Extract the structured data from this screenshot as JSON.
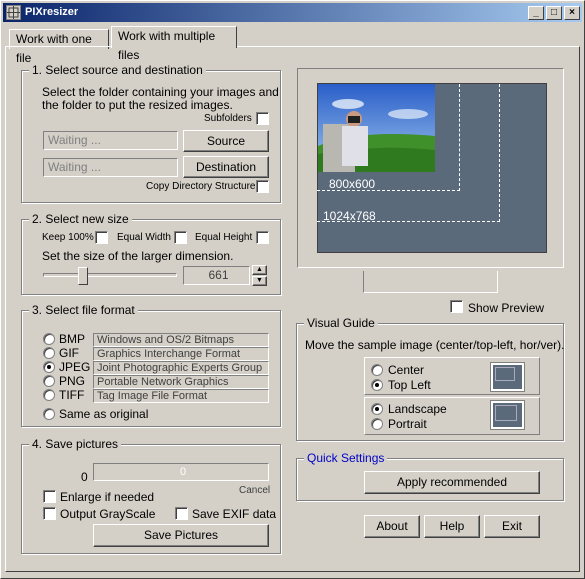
{
  "window": {
    "title": "PIXresizer"
  },
  "tabs": [
    {
      "label": "Work with one file"
    },
    {
      "label": "Work with multiple files"
    }
  ],
  "source_group": {
    "legend": "1. Select source and destination",
    "description_line1": "Select the folder containing your images and",
    "description_line2": "the folder to put the resized images.",
    "subfolders_label": "Subfolders",
    "source_value": "Waiting ...",
    "source_button": "Source",
    "destination_value": "Waiting ...",
    "destination_button": "Destination",
    "copy_structure_label": "Copy Directory Structure"
  },
  "size_group": {
    "legend": "2. Select new size",
    "keep_label": "Keep 100%",
    "equal_width_label": "Equal Width",
    "equal_height_label": "Equal Height",
    "instruction": "Set the size of the larger dimension.",
    "size_value": "661",
    "slider_fraction": 0.28
  },
  "format_group": {
    "legend": "3. Select file format",
    "formats": [
      {
        "name": "BMP",
        "desc": "Windows and OS/2 Bitmaps",
        "selected": false
      },
      {
        "name": "GIF",
        "desc": "Graphics Interchange Format",
        "selected": false
      },
      {
        "name": "JPEG",
        "desc": "Joint Photographic Experts Group",
        "selected": true
      },
      {
        "name": "PNG",
        "desc": "Portable Network Graphics",
        "selected": false
      },
      {
        "name": "TIFF",
        "desc": "Tag Image File Format",
        "selected": false
      }
    ],
    "same_as_original": "Same as original"
  },
  "save_group": {
    "legend": "4. Save pictures",
    "count": "0",
    "progress_text": "0",
    "cancel_label": "Cancel",
    "enlarge_label": "Enlarge if needed",
    "grayscale_label": "Output GrayScale",
    "exif_label": "Save EXIF data",
    "save_button": "Save Pictures"
  },
  "preview": {
    "label_800": "800x600",
    "label_1024": "1024x768",
    "show_preview_label": "Show Preview"
  },
  "visual_guide": {
    "legend": "Visual Guide",
    "instruction": "Move the sample image (center/top-left, hor/ver).",
    "center_label": "Center",
    "topleft_label": "Top Left",
    "landscape_label": "Landscape",
    "portrait_label": "Portrait"
  },
  "quick_settings": {
    "legend": "Quick Settings",
    "apply_button": "Apply recommended"
  },
  "footer": {
    "about": "About",
    "help": "Help",
    "exit": "Exit"
  }
}
